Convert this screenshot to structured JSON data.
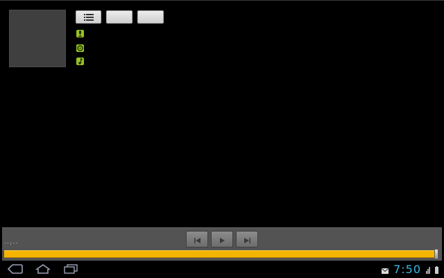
{
  "player": {
    "time_elapsed": "--:--",
    "progress": 0.995
  },
  "icons": {
    "playlist": "playlist-icon",
    "artist": "microphone-icon",
    "album": "disc-icon",
    "track": "music-note-icon",
    "previous": "previous-track-icon",
    "play": "play-icon",
    "next": "next-track-icon",
    "back": "back-icon",
    "home": "home-icon",
    "recents": "recent-apps-icon",
    "notification": "mail-icon",
    "signal": "signal-icon",
    "battery": "battery-icon"
  },
  "status_bar": {
    "clock": "7:50"
  },
  "colors": {
    "accent": "#f5b400",
    "info_icon": "#97c11f",
    "clock": "#3ab9e6"
  }
}
